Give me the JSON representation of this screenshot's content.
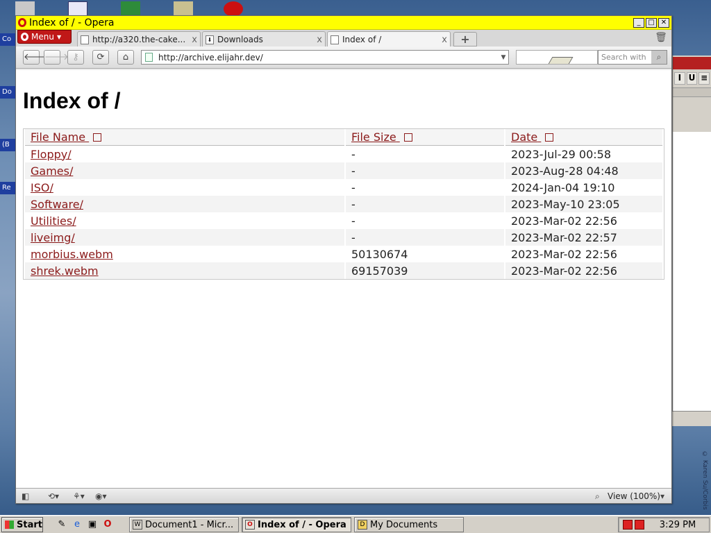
{
  "window": {
    "title": "Index of / - Opera",
    "min_label": "_",
    "max_label": "□",
    "close_label": "✕"
  },
  "menu": {
    "label": "Menu"
  },
  "tabs": [
    {
      "label": "http://a320.the-cake...",
      "close": "x"
    },
    {
      "label": "Downloads",
      "close": "x"
    },
    {
      "label": "Index of /",
      "close": "x",
      "active": true
    }
  ],
  "newtab_label": "+",
  "address": {
    "url": "http://archive.elijahr.dev/"
  },
  "search": {
    "placeholder": "Search with"
  },
  "page": {
    "heading": "Index of /",
    "columns": [
      "File Name",
      "File Size",
      "Date"
    ],
    "rows": [
      {
        "name": "Floppy/",
        "size": "-",
        "date": "2023-Jul-29 00:58"
      },
      {
        "name": "Games/",
        "size": "-",
        "date": "2023-Aug-28 04:48"
      },
      {
        "name": "ISO/",
        "size": "-",
        "date": "2024-Jan-04 19:10"
      },
      {
        "name": "Software/",
        "size": "-",
        "date": "2023-May-10 23:05"
      },
      {
        "name": "Utilities/",
        "size": "-",
        "date": "2023-Mar-02 22:56"
      },
      {
        "name": "liveimg/",
        "size": "-",
        "date": "2023-Mar-02 22:57"
      },
      {
        "name": "morbius.webm",
        "size": "50130674",
        "date": "2023-Mar-02 22:56"
      },
      {
        "name": "shrek.webm",
        "size": "69157039",
        "date": "2023-Mar-02 22:56"
      }
    ]
  },
  "statusbar": {
    "zoom_label": "View (100%)"
  },
  "taskbar": {
    "start_label": "Start",
    "tasks": [
      {
        "label": "Document1 - Micr...",
        "icon": "W"
      },
      {
        "label": "Index of / - Opera",
        "icon": "O",
        "active": true
      },
      {
        "label": "My Documents",
        "icon": "D"
      }
    ],
    "clock": "3:29 PM"
  },
  "desktop": {
    "labels": [
      "Co",
      "Do",
      "(B",
      "Re"
    ],
    "copyright": "© Karen Su/Corbis"
  },
  "colors": {
    "titlebar": "#ffff00",
    "link": "#8b1a1a",
    "menu": "#c01818"
  }
}
